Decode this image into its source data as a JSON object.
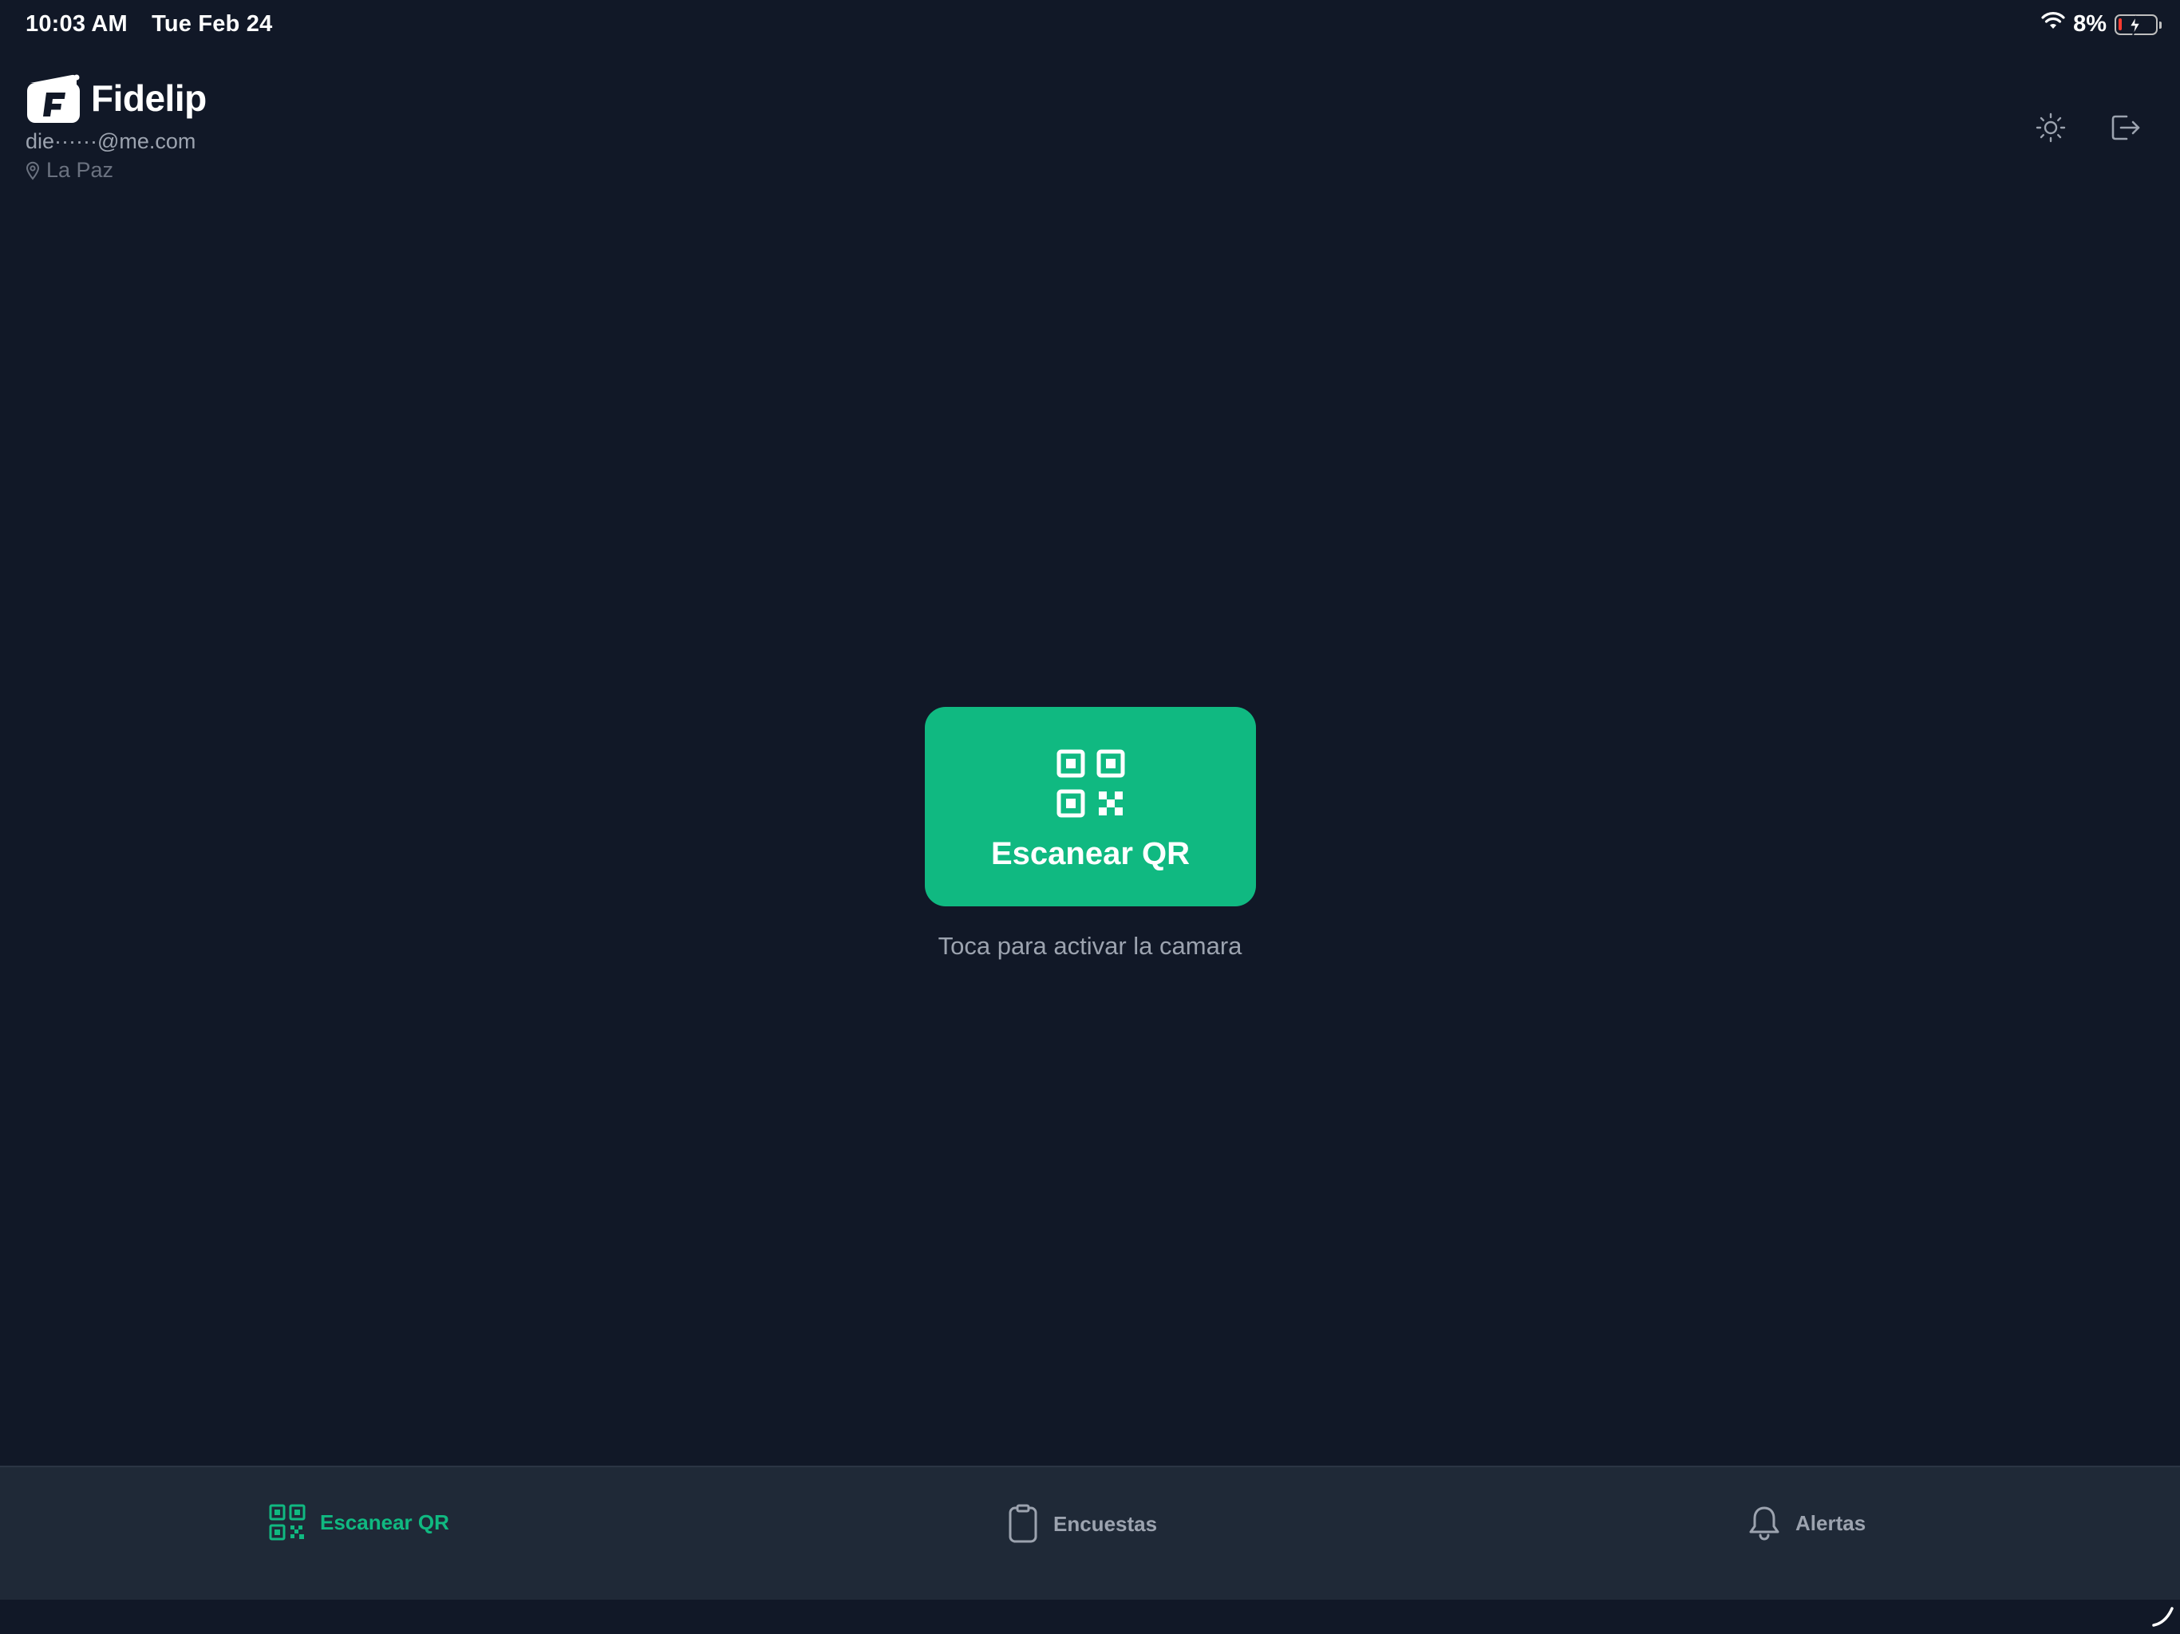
{
  "status_bar": {
    "time": "10:03 AM",
    "date": "Tue Feb 24",
    "battery_percent": "8%",
    "battery_level": 0.08
  },
  "header": {
    "brand_name": "Fidelip",
    "email": "die······@me.com",
    "location": "La Paz"
  },
  "main": {
    "scan_button_label": "Escanear QR",
    "hint": "Toca para activar la camara"
  },
  "tabs": [
    {
      "label": "Escanear QR",
      "icon": "qr-code-icon",
      "active": true
    },
    {
      "label": "Encuestas",
      "icon": "clipboard-icon",
      "active": false
    },
    {
      "label": "Alertas",
      "icon": "bell-icon",
      "active": false
    }
  ],
  "colors": {
    "background": "#111827",
    "accent": "#10b981",
    "tab_bar": "#1f2937",
    "muted_text": "#9ca3af"
  }
}
